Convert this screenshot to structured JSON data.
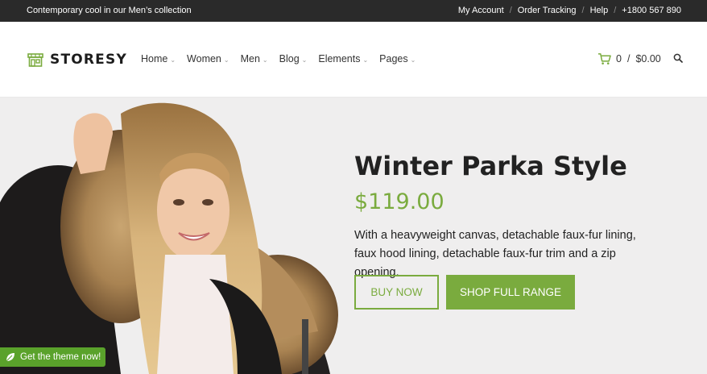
{
  "topbar": {
    "promo": "Contemporary cool in our Men’s collection",
    "links": [
      "My Account",
      "Order Tracking",
      "Help",
      "+1800 567 890"
    ]
  },
  "header": {
    "logo_text": "STORESY",
    "nav": [
      {
        "label": "Home"
      },
      {
        "label": "Women"
      },
      {
        "label": "Men"
      },
      {
        "label": "Blog"
      },
      {
        "label": "Elements"
      },
      {
        "label": "Pages"
      }
    ],
    "cart_count": "0",
    "cart_separator": "/",
    "cart_total": "$0.00"
  },
  "hero": {
    "title": "Winter Parka Style",
    "price": "$119.00",
    "description": "With a heavyweight canvas, detachable faux-fur lining, faux hood lining, detachable faux-fur trim and a zip opening.",
    "primary_button": "BUY NOW",
    "secondary_button": "SHOP FULL RANGE"
  },
  "badge": {
    "label": "Get the theme now!"
  },
  "colors": {
    "accent": "#7aab3e",
    "topbar_bg": "#2a2a2a",
    "hero_bg": "#efeeee",
    "badge_bg": "#5aa22b"
  },
  "icons": {
    "logo": "storefront-icon",
    "cart": "shopping-cart-icon",
    "search": "search-icon",
    "badge": "leaf-icon"
  }
}
